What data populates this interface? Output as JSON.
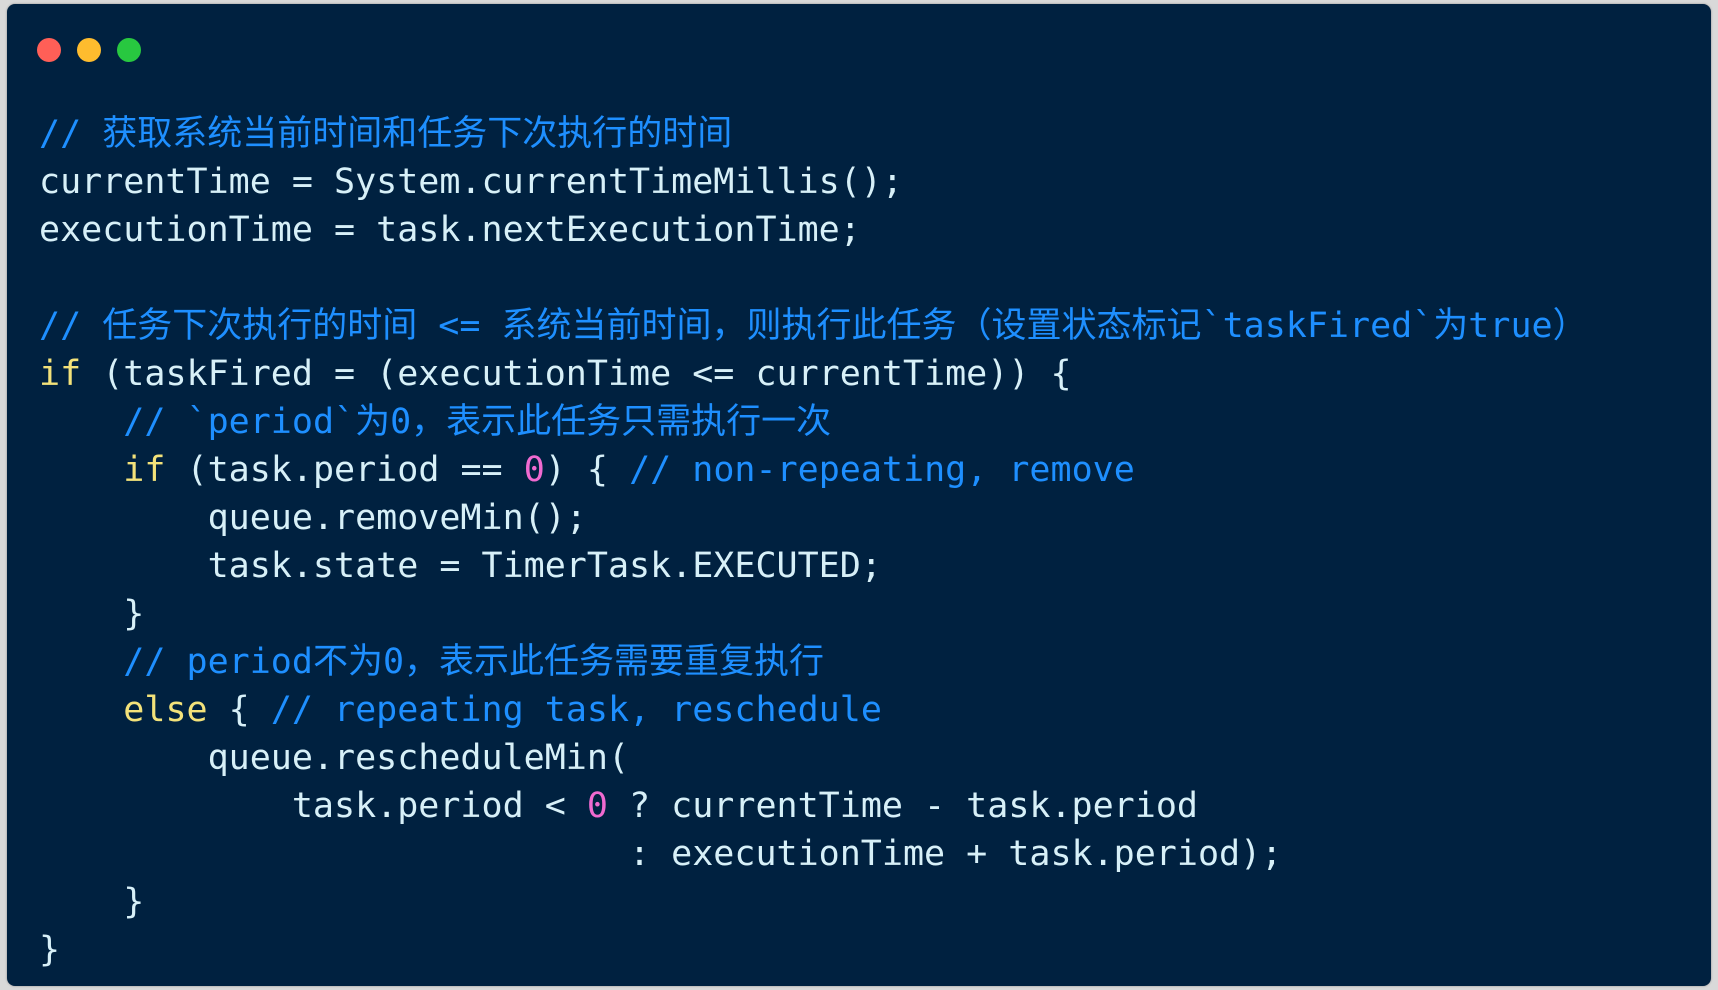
{
  "window": {
    "controls": {
      "close_color": "#ff5f57",
      "minimize_color": "#febc2e",
      "maximize_color": "#28c840"
    }
  },
  "code": {
    "language": "java",
    "colors": {
      "background": "#002140",
      "text": "#d7f0f8",
      "comment": "#1e8fff",
      "keyword": "#f3e27a",
      "number": "#f06ad0"
    },
    "lines": [
      [
        {
          "t": "// 获取系统当前时间和任务下次执行的时间",
          "c": "c"
        }
      ],
      [
        {
          "t": "currentTime = System.currentTimeMillis();",
          "c": "t"
        }
      ],
      [
        {
          "t": "executionTime = task.nextExecutionTime;",
          "c": "t"
        }
      ],
      [],
      [
        {
          "t": "// 任务下次执行的时间 <= 系统当前时间，则执行此任务（设置状态标记`taskFired`为true）",
          "c": "c"
        }
      ],
      [
        {
          "t": "if",
          "c": "k"
        },
        {
          "t": " (taskFired = (executionTime <= currentTime)) {",
          "c": "t"
        }
      ],
      [
        {
          "t": "    ",
          "c": "t"
        },
        {
          "t": "// `period`为0，表示此任务只需执行一次",
          "c": "c"
        }
      ],
      [
        {
          "t": "    ",
          "c": "t"
        },
        {
          "t": "if",
          "c": "k"
        },
        {
          "t": " (task.period == ",
          "c": "t"
        },
        {
          "t": "0",
          "c": "n"
        },
        {
          "t": ") { ",
          "c": "t"
        },
        {
          "t": "// non-repeating, remove",
          "c": "c"
        }
      ],
      [
        {
          "t": "        queue.removeMin();",
          "c": "t"
        }
      ],
      [
        {
          "t": "        task.state = TimerTask.EXECUTED;",
          "c": "t"
        }
      ],
      [
        {
          "t": "    }",
          "c": "t"
        }
      ],
      [
        {
          "t": "    ",
          "c": "t"
        },
        {
          "t": "// period不为0，表示此任务需要重复执行",
          "c": "c"
        }
      ],
      [
        {
          "t": "    ",
          "c": "t"
        },
        {
          "t": "else",
          "c": "k"
        },
        {
          "t": " { ",
          "c": "t"
        },
        {
          "t": "// repeating task, reschedule",
          "c": "c"
        }
      ],
      [
        {
          "t": "        queue.rescheduleMin(",
          "c": "t"
        }
      ],
      [
        {
          "t": "            task.period < ",
          "c": "t"
        },
        {
          "t": "0",
          "c": "n"
        },
        {
          "t": " ? currentTime - task.period",
          "c": "t"
        }
      ],
      [
        {
          "t": "                            : executionTime + task.period);",
          "c": "t"
        }
      ],
      [
        {
          "t": "    }",
          "c": "t"
        }
      ],
      [
        {
          "t": "}",
          "c": "t"
        }
      ]
    ]
  }
}
